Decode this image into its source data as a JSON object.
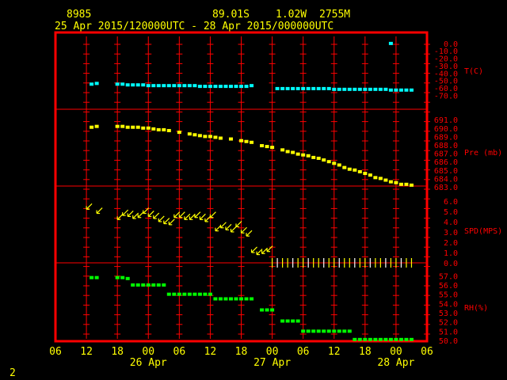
{
  "header": {
    "station_id": "8985",
    "lat": "89.01S",
    "lon": "1.02W",
    "elevation": "2755M",
    "time_range": "25 Apr 2015/120000UTC - 28 Apr 2015/000000UTC"
  },
  "footer": {
    "page_number": "2"
  },
  "colors": {
    "background": "#000000",
    "frame": "#ff0000",
    "text": "#ffff00",
    "label": "#ff0000",
    "temperature": "#00ffff",
    "pressure": "#ffff00",
    "wind": "#ffff00",
    "humidity": "#00ff00",
    "ticks": "#ffffff"
  },
  "chart_data": {
    "type": "scatter",
    "x_ticks": [
      "06",
      "12",
      "18",
      "00",
      "06",
      "12",
      "18",
      "00",
      "06",
      "12",
      "18",
      "00",
      "06"
    ],
    "x_date_labels": [
      {
        "hour_index": 3,
        "text": "26 Apr"
      },
      {
        "hour_index": 7,
        "text": "27 Apr"
      },
      {
        "hour_index": 11,
        "text": "28 Apr"
      }
    ],
    "x_unit_note": "x = hours after 25 Apr 2015 00 UTC",
    "panels": [
      {
        "name": "temperature",
        "label": "T(C)",
        "y_ticks": [
          "0.0",
          "-10.0",
          "-20.0",
          "-30.0",
          "-40.0",
          "-50.0",
          "-60.0",
          "-70.0"
        ],
        "ylim": [
          -75,
          2
        ],
        "series": [
          {
            "color": "#00ffff",
            "x": [
              13,
              14,
              18,
              19,
              20,
              21,
              22,
              23,
              24,
              25,
              26,
              27,
              28,
              29,
              30,
              31,
              32,
              33,
              34,
              35,
              36,
              37,
              38,
              39,
              40,
              41,
              42,
              43,
              44,
              49,
              50,
              51,
              52,
              53,
              54,
              55,
              56,
              57,
              58,
              59,
              60,
              61,
              62,
              63,
              64,
              65,
              66,
              67,
              68,
              69,
              70,
              71,
              72,
              73,
              74,
              75,
              71
            ],
            "y": [
              -55,
              -54,
              -55,
              -55,
              -56,
              -56,
              -56,
              -56,
              -57,
              -57,
              -57,
              -57,
              -57,
              -57,
              -57,
              -57,
              -57,
              -57,
              -58,
              -58,
              -58,
              -58,
              -58,
              -58,
              -58,
              -58,
              -58,
              -58,
              -57,
              -61,
              -61,
              -61,
              -61,
              -61,
              -61,
              -61,
              -61,
              -61,
              -61,
              -61,
              -62,
              -62,
              -62,
              -62,
              -62,
              -62,
              -62,
              -62,
              -62,
              -62,
              -62,
              -63,
              -63,
              -63,
              -63,
              -63,
              0
            ]
          }
        ]
      },
      {
        "name": "pressure",
        "label": "Pre (mb)",
        "y_ticks": [
          "691.0",
          "690.0",
          "689.0",
          "688.0",
          "687.0",
          "686.0",
          "685.0",
          "684.0",
          "683.0"
        ],
        "ylim": [
          683,
          691.3
        ],
        "series": [
          {
            "color": "#ffff00",
            "x": [
              13,
              14,
              18,
              19,
              20,
              21,
              22,
              23,
              24,
              25,
              26,
              27,
              28,
              30,
              32,
              33,
              34,
              35,
              36,
              37,
              38,
              40,
              42,
              43,
              44,
              46,
              47,
              48,
              50,
              51,
              52,
              53,
              54,
              55,
              56,
              57,
              58,
              59,
              60,
              61,
              62,
              63,
              64,
              65,
              66,
              67,
              68,
              69,
              70,
              71,
              72,
              73,
              74,
              75
            ],
            "y": [
              690.1,
              690.2,
              690.2,
              690.2,
              690.1,
              690.1,
              690.1,
              690.0,
              690.0,
              689.9,
              689.8,
              689.8,
              689.7,
              689.5,
              689.3,
              689.2,
              689.1,
              689.0,
              689.0,
              688.9,
              688.8,
              688.7,
              688.5,
              688.4,
              688.3,
              687.9,
              687.8,
              687.7,
              687.4,
              687.2,
              687.1,
              686.9,
              686.8,
              686.7,
              686.5,
              686.4,
              686.2,
              686.0,
              685.8,
              685.6,
              685.3,
              685.1,
              685.0,
              684.8,
              684.6,
              684.4,
              684.1,
              684.0,
              683.8,
              683.6,
              683.5,
              683.3,
              683.3,
              683.2
            ]
          }
        ]
      },
      {
        "name": "wind",
        "label": "SPD(MPS)",
        "y_ticks": [
          "6.0",
          "5.0",
          "4.0",
          "3.0",
          "2.0",
          "1.0",
          "0.0"
        ],
        "ylim": [
          0,
          6.3
        ],
        "series": [
          {
            "color": "#ffff00",
            "x": [
              12,
              14,
              18,
              19,
              20,
              21,
              22,
              23,
              24,
              25,
              26,
              27,
              28,
              29,
              30,
              31,
              32,
              33,
              34,
              35,
              36,
              37,
              38,
              39,
              40,
              41,
              42,
              43,
              44,
              45,
              46,
              47,
              48,
              49,
              50,
              51,
              52,
              53,
              54,
              55,
              56,
              57,
              58,
              59,
              60,
              61,
              62,
              63,
              64,
              65,
              66,
              67,
              68,
              69,
              70,
              71,
              72,
              73,
              74,
              75
            ],
            "y": [
              5.2,
              4.8,
              4.2,
              4.6,
              4.5,
              4.3,
              4.4,
              4.8,
              4.5,
              4.3,
              4.0,
              3.8,
              3.7,
              4.4,
              4.4,
              4.2,
              4.2,
              4.4,
              4.2,
              4.0,
              4.4,
              3.1,
              3.4,
              3.2,
              3.0,
              3.5,
              2.9,
              2.6,
              1.0,
              0.8,
              0.9,
              1.1,
              0,
              0,
              0,
              0,
              0,
              0,
              0,
              0,
              0,
              0,
              0,
              0,
              0,
              0,
              0,
              0,
              0,
              0,
              0,
              0,
              0,
              0,
              0,
              0,
              0,
              0,
              0,
              0
            ]
          }
        ]
      },
      {
        "name": "humidity",
        "label": "RH(%)",
        "y_ticks": [
          "57.0",
          "56.0",
          "55.0",
          "54.0",
          "53.0",
          "52.0",
          "51.0",
          "50.0"
        ],
        "ylim": [
          50,
          57.2
        ],
        "series": [
          {
            "color": "#00ff00",
            "x": [
              13,
              14,
              18,
              19,
              20,
              21,
              22,
              23,
              24,
              25,
              26,
              27,
              28,
              29,
              30,
              31,
              32,
              33,
              34,
              35,
              36,
              37,
              38,
              39,
              40,
              41,
              42,
              43,
              44,
              46,
              47,
              48,
              50,
              51,
              52,
              53,
              54,
              55,
              56,
              57,
              58,
              59,
              60,
              61,
              62,
              63,
              64,
              65,
              66,
              67,
              68,
              69,
              70,
              71,
              72,
              73,
              74,
              75
            ],
            "y": [
              56.8,
              56.8,
              56.8,
              56.8,
              56.7,
              56.0,
              56.0,
              56.0,
              56.0,
              56.0,
              56.0,
              56.0,
              55.0,
              55.0,
              55.0,
              55.0,
              55.0,
              55.0,
              55.0,
              55.0,
              55.0,
              54.5,
              54.5,
              54.5,
              54.5,
              54.5,
              54.5,
              54.5,
              54.5,
              53.3,
              53.3,
              53.3,
              52.1,
              52.1,
              52.1,
              52.1,
              51.0,
              51.0,
              51.0,
              51.0,
              51.0,
              51.0,
              51.0,
              51.0,
              51.0,
              51.0,
              50.1,
              50.1,
              50.1,
              50.1,
              50.1,
              50.1,
              50.1,
              50.1,
              50.1,
              50.1,
              50.1,
              50.1
            ]
          }
        ]
      }
    ]
  }
}
